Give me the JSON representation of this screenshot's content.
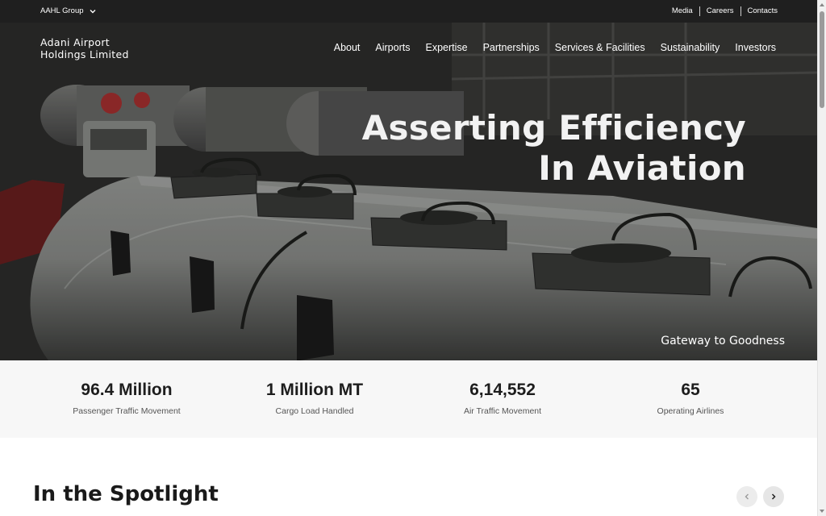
{
  "topbar": {
    "group_label": "AAHL Group",
    "links": [
      "Media",
      "Careers",
      "Contacts"
    ]
  },
  "brand": {
    "line1": "Adani Airport",
    "line2": "Holdings Limited"
  },
  "nav": [
    "About",
    "Airports",
    "Expertise",
    "Partnerships",
    "Services & Facilities",
    "Sustainability",
    "Investors"
  ],
  "hero": {
    "headline_line1": "Asserting Efficiency",
    "headline_line2": "In Aviation",
    "tagline": "Gateway to Goodness"
  },
  "stats": [
    {
      "value": "96.4 Million",
      "label": "Passenger Traffic Movement"
    },
    {
      "value": "1 Million MT",
      "label": "Cargo Load Handled"
    },
    {
      "value": "6,14,552",
      "label": "Air Traffic Movement"
    },
    {
      "value": "65",
      "label": "Operating Airlines"
    }
  ],
  "spotlight": {
    "title": "In the Spotlight"
  },
  "icons": {
    "group_dropdown": "chevron-down-icon",
    "prev": "chevron-left-icon",
    "next": "chevron-right-icon"
  },
  "colors": {
    "topbar_bg": "#1f1f1f",
    "stats_bg": "#f7f7f7",
    "text_dark": "#1a1a1a"
  }
}
